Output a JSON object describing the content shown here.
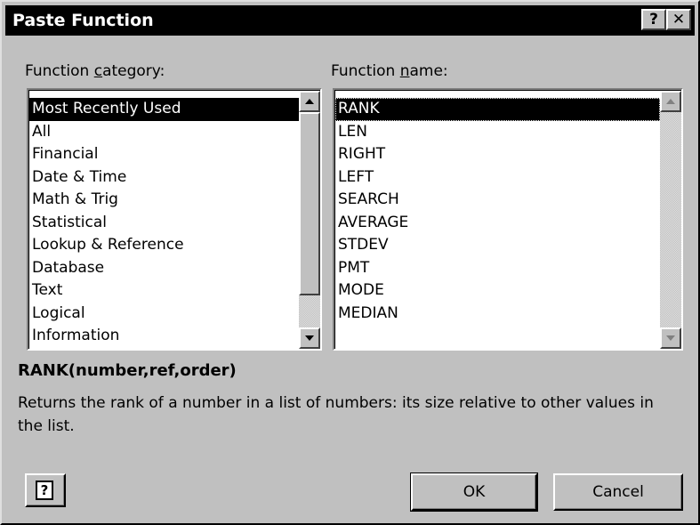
{
  "window": {
    "title": "Paste Function",
    "help_glyph": "?",
    "close_glyph": "✕"
  },
  "category": {
    "label_pre": "Function ",
    "label_access": "c",
    "label_post": "ategory:",
    "items": [
      "Most Recently Used",
      "All",
      "Financial",
      "Date & Time",
      "Math & Trig",
      "Statistical",
      "Lookup & Reference",
      "Database",
      "Text",
      "Logical",
      "Information"
    ],
    "selected": "Most Recently Used"
  },
  "function": {
    "label_pre": "Function ",
    "label_access": "n",
    "label_post": "ame:",
    "items": [
      "RANK",
      "LEN",
      "RIGHT",
      "LEFT",
      "SEARCH",
      "AVERAGE",
      "STDEV",
      "PMT",
      "MODE",
      "MEDIAN"
    ],
    "selected": "RANK"
  },
  "syntax": "RANK(number,ref,order)",
  "description": "Returns the rank of a number in a list of numbers: its size relative to other values in the list.",
  "buttons": {
    "help_glyph": "?",
    "ok": "OK",
    "cancel": "Cancel"
  }
}
